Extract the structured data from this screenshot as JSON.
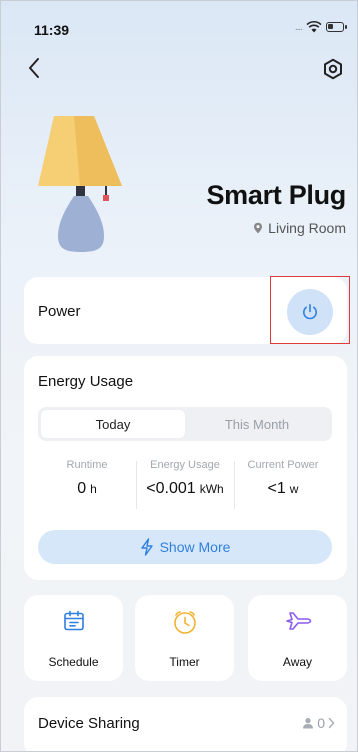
{
  "status_bar": {
    "time": "11:39",
    "signal_dots": "...."
  },
  "device": {
    "name": "Smart Plug",
    "room": "Living Room"
  },
  "power": {
    "label": "Power",
    "state": "off"
  },
  "energy": {
    "title": "Energy Usage",
    "tabs": [
      {
        "label": "Today",
        "active": true
      },
      {
        "label": "This Month",
        "active": false
      }
    ],
    "stats": [
      {
        "label": "Runtime",
        "value": "0",
        "unit": "h"
      },
      {
        "label": "Energy Usage",
        "value": "<0.001",
        "unit": "kWh"
      },
      {
        "label": "Current Power",
        "value": "<1",
        "unit": "w"
      }
    ],
    "show_more": "Show More"
  },
  "actions": [
    {
      "label": "Schedule",
      "icon": "calendar-icon",
      "color": "#2f7fe0"
    },
    {
      "label": "Timer",
      "icon": "clock-icon",
      "color": "#f2b233"
    },
    {
      "label": "Away",
      "icon": "airplane-icon",
      "color": "#8a5cf0"
    }
  ],
  "sharing": {
    "label": "Device Sharing",
    "count": "0"
  },
  "colors": {
    "accent": "#2f7fe0",
    "power_bg": "#cfe2f8",
    "highlight": "#e03a3a"
  }
}
